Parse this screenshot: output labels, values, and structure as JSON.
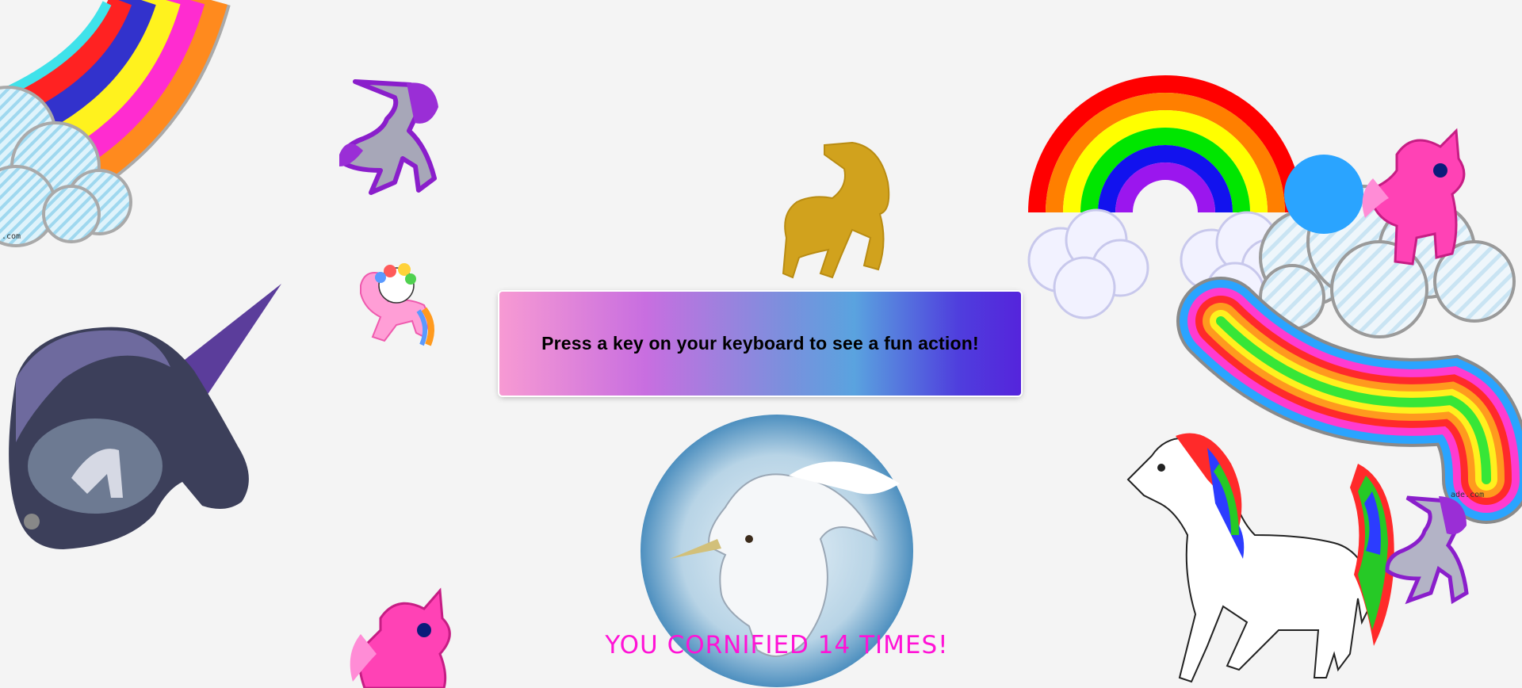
{
  "prompt": {
    "text": "Press a key on your keyboard to see a fun action!"
  },
  "counter": {
    "text": "YOU CORNIFIED 14 TIMES!"
  },
  "watermarks": {
    "left": ".com",
    "right": "ade.com"
  },
  "colors": {
    "background": "#f4f4f4",
    "counter_text": "#ff12d6",
    "gradient": [
      "#f79ad3",
      "#c86ee0",
      "#5aa3df",
      "#5524dc"
    ]
  },
  "sprites": [
    {
      "name": "glitter-rainbow-top-left-image"
    },
    {
      "name": "purple-glitter-unicorn-image"
    },
    {
      "name": "gold-glitter-unicorn-image"
    },
    {
      "name": "rainbow-clouds-image"
    },
    {
      "name": "pink-glitter-pony-top-right-image"
    },
    {
      "name": "rainbow-swirl-clouds-image"
    },
    {
      "name": "hello-kitty-pony-image"
    },
    {
      "name": "dark-unicorn-head-image"
    },
    {
      "name": "white-unicorn-circle-image"
    },
    {
      "name": "pink-glitter-pony-bottom-image"
    },
    {
      "name": "white-rainbow-mane-unicorn-image"
    },
    {
      "name": "small-purple-unicorn-image"
    }
  ]
}
